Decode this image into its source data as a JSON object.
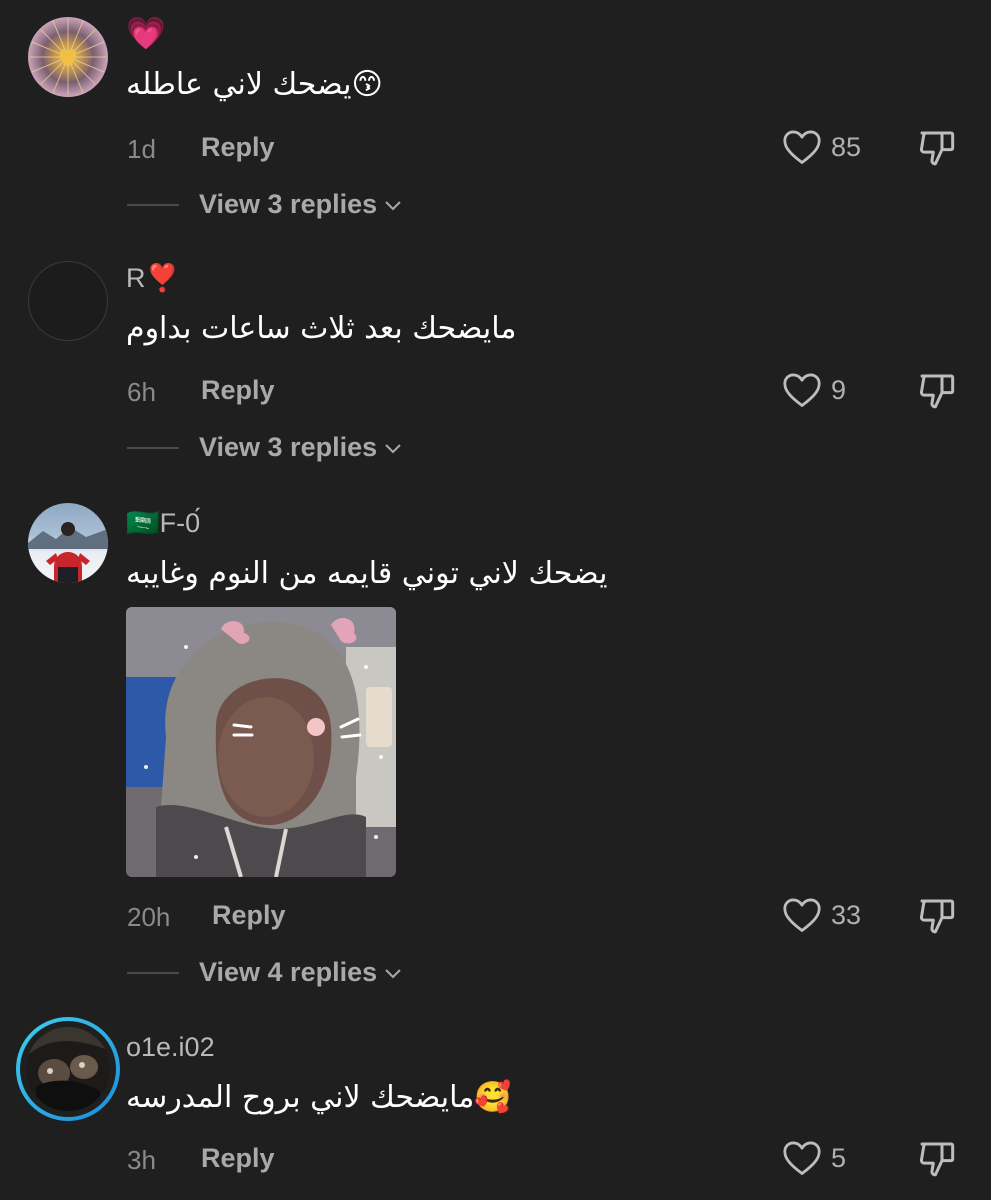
{
  "comments": [
    {
      "username": "💗",
      "text": "يضحك لاني عاطله😙",
      "time": "1d",
      "reply_label": "Reply",
      "likes": "85",
      "view_replies": "View 3 replies"
    },
    {
      "username": "R❣️",
      "text": "مايضحك بعد ثلاث ساعات بداوم",
      "time": "6h",
      "reply_label": "Reply",
      "likes": "9",
      "view_replies": "View 3 replies"
    },
    {
      "username": "🇸🇦F-0́",
      "text": "يضحك لاني توني قايمه من النوم وغايبه",
      "time": "20h",
      "reply_label": "Reply",
      "likes": "33",
      "view_replies": "View 4 replies"
    },
    {
      "username": "o1e.i02",
      "text": "مايضحك لاني بروح المدرسه🥰",
      "time": "3h",
      "reply_label": "Reply",
      "likes": "5"
    }
  ],
  "icons": {
    "like": "heart-outline-icon",
    "dislike": "thumbs-down-icon",
    "expand": "chevron-down-icon"
  },
  "colors": {
    "background": "#1f1f1f",
    "story_ring": "#1ea1f2"
  }
}
